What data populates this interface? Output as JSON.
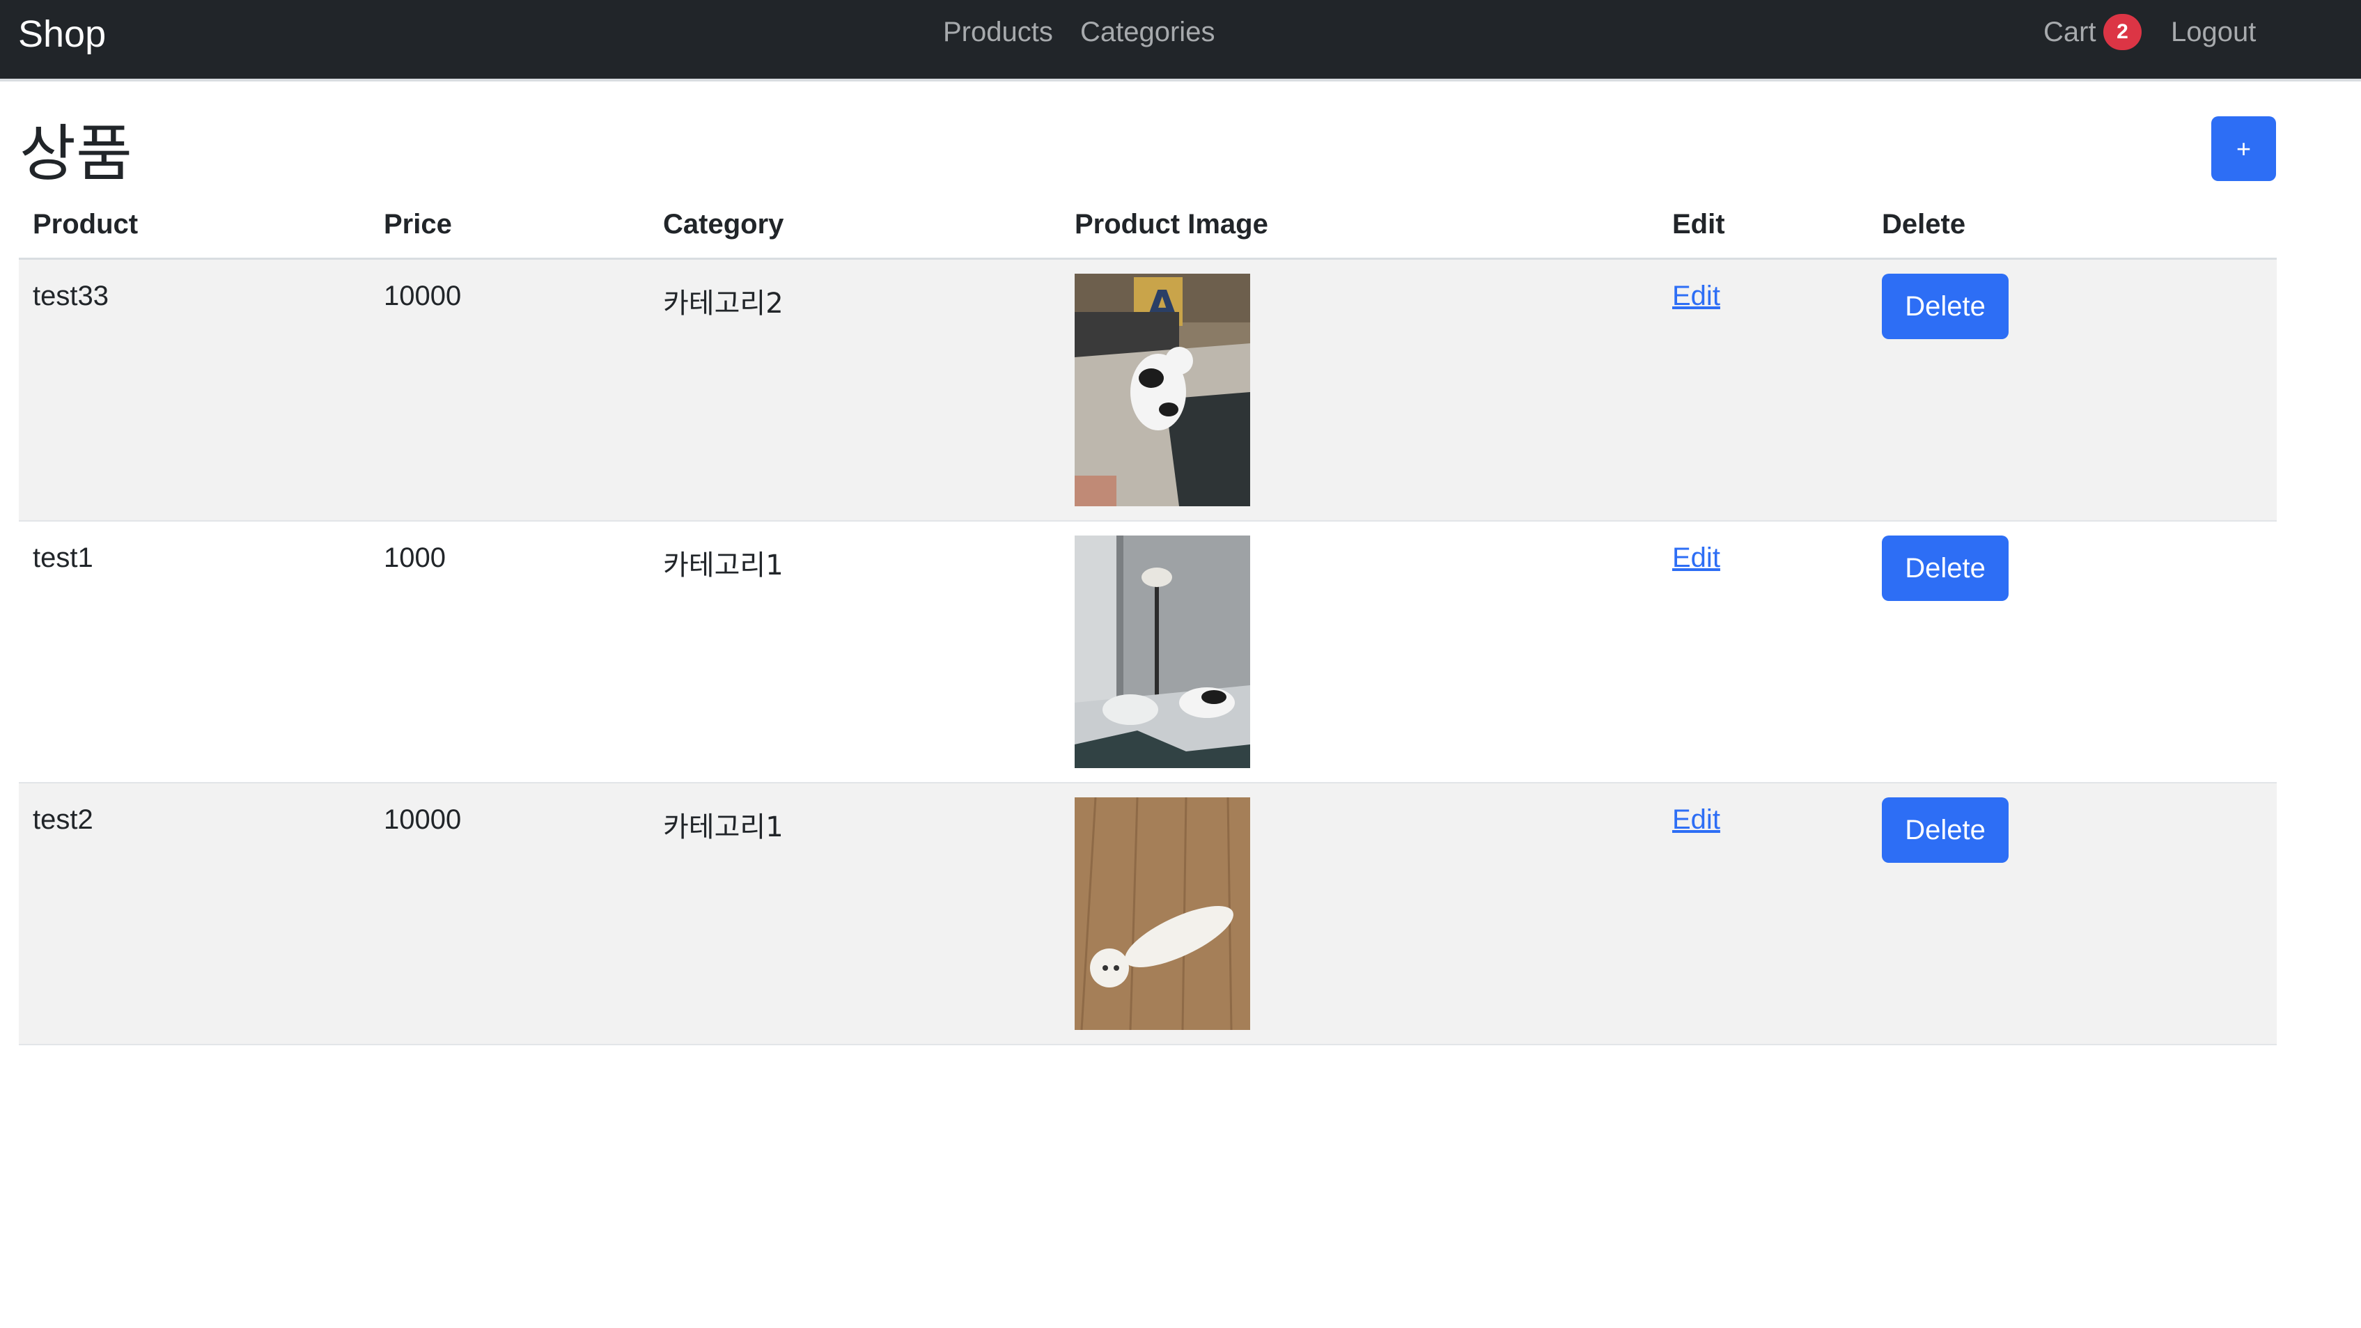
{
  "nav": {
    "brand": "Shop",
    "links": [
      "Products",
      "Categories"
    ],
    "cart_label": "Cart",
    "cart_count": "2",
    "logout_label": "Logout"
  },
  "page": {
    "title": "상품",
    "add_button": "+"
  },
  "table": {
    "headers": [
      "Product",
      "Price",
      "Category",
      "Product Image",
      "Edit",
      "Delete"
    ],
    "rows": [
      {
        "product": "test33",
        "price": "10000",
        "category": "카테고리2",
        "edit": "Edit",
        "delete": "Delete"
      },
      {
        "product": "test1",
        "price": "1000",
        "category": "카테고리1",
        "edit": "Edit",
        "delete": "Delete"
      },
      {
        "product": "test2",
        "price": "10000",
        "category": "카테고리1",
        "edit": "Edit",
        "delete": "Delete"
      }
    ]
  },
  "colors": {
    "navbar": "#212529",
    "primary": "#2d6ef5",
    "badge": "#dc3545",
    "stripe": "#f2f2f2"
  }
}
